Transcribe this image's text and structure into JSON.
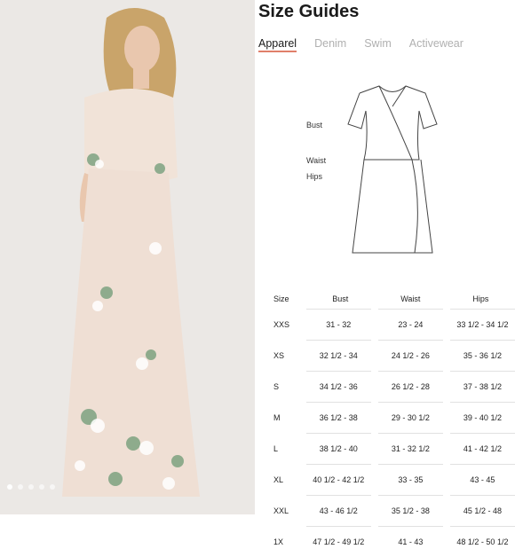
{
  "photo": {
    "alt": "model-in-floral-off-shoulder-maxi-dress"
  },
  "carousel": {
    "dots": [
      1,
      2,
      3,
      4,
      5
    ]
  },
  "guide": {
    "title": "Size Guides",
    "tabs": [
      "Apparel",
      "Denim",
      "Swim",
      "Activewear"
    ],
    "diagram_labels": {
      "bust": "Bust",
      "waist": "Waist",
      "hips": "Hips"
    },
    "table": {
      "headers": [
        "Size",
        "Bust",
        "Waist",
        "Hips"
      ],
      "rows": [
        [
          "XXS",
          "31 - 32",
          "23 - 24",
          "33 1/2 - 34 1/2"
        ],
        [
          "XS",
          "32 1/2 - 34",
          "24 1/2 - 26",
          "35 - 36 1/2"
        ],
        [
          "S",
          "34 1/2 - 36",
          "26 1/2 - 28",
          "37 - 38 1/2"
        ],
        [
          "M",
          "36 1/2 - 38",
          "29 - 30 1/2",
          "39 - 40 1/2"
        ],
        [
          "L",
          "38 1/2 - 40",
          "31 - 32 1/2",
          "41 - 42 1/2"
        ],
        [
          "XL",
          "40 1/2 - 42 1/2",
          "33 - 35",
          "43 - 45"
        ],
        [
          "XXL",
          "43 - 46 1/2",
          "35 1/2 - 38",
          "45 1/2 - 48"
        ],
        [
          "1X",
          "47 1/2 - 49 1/2",
          "41 - 43",
          "48 1/2 - 50 1/2"
        ]
      ]
    }
  }
}
